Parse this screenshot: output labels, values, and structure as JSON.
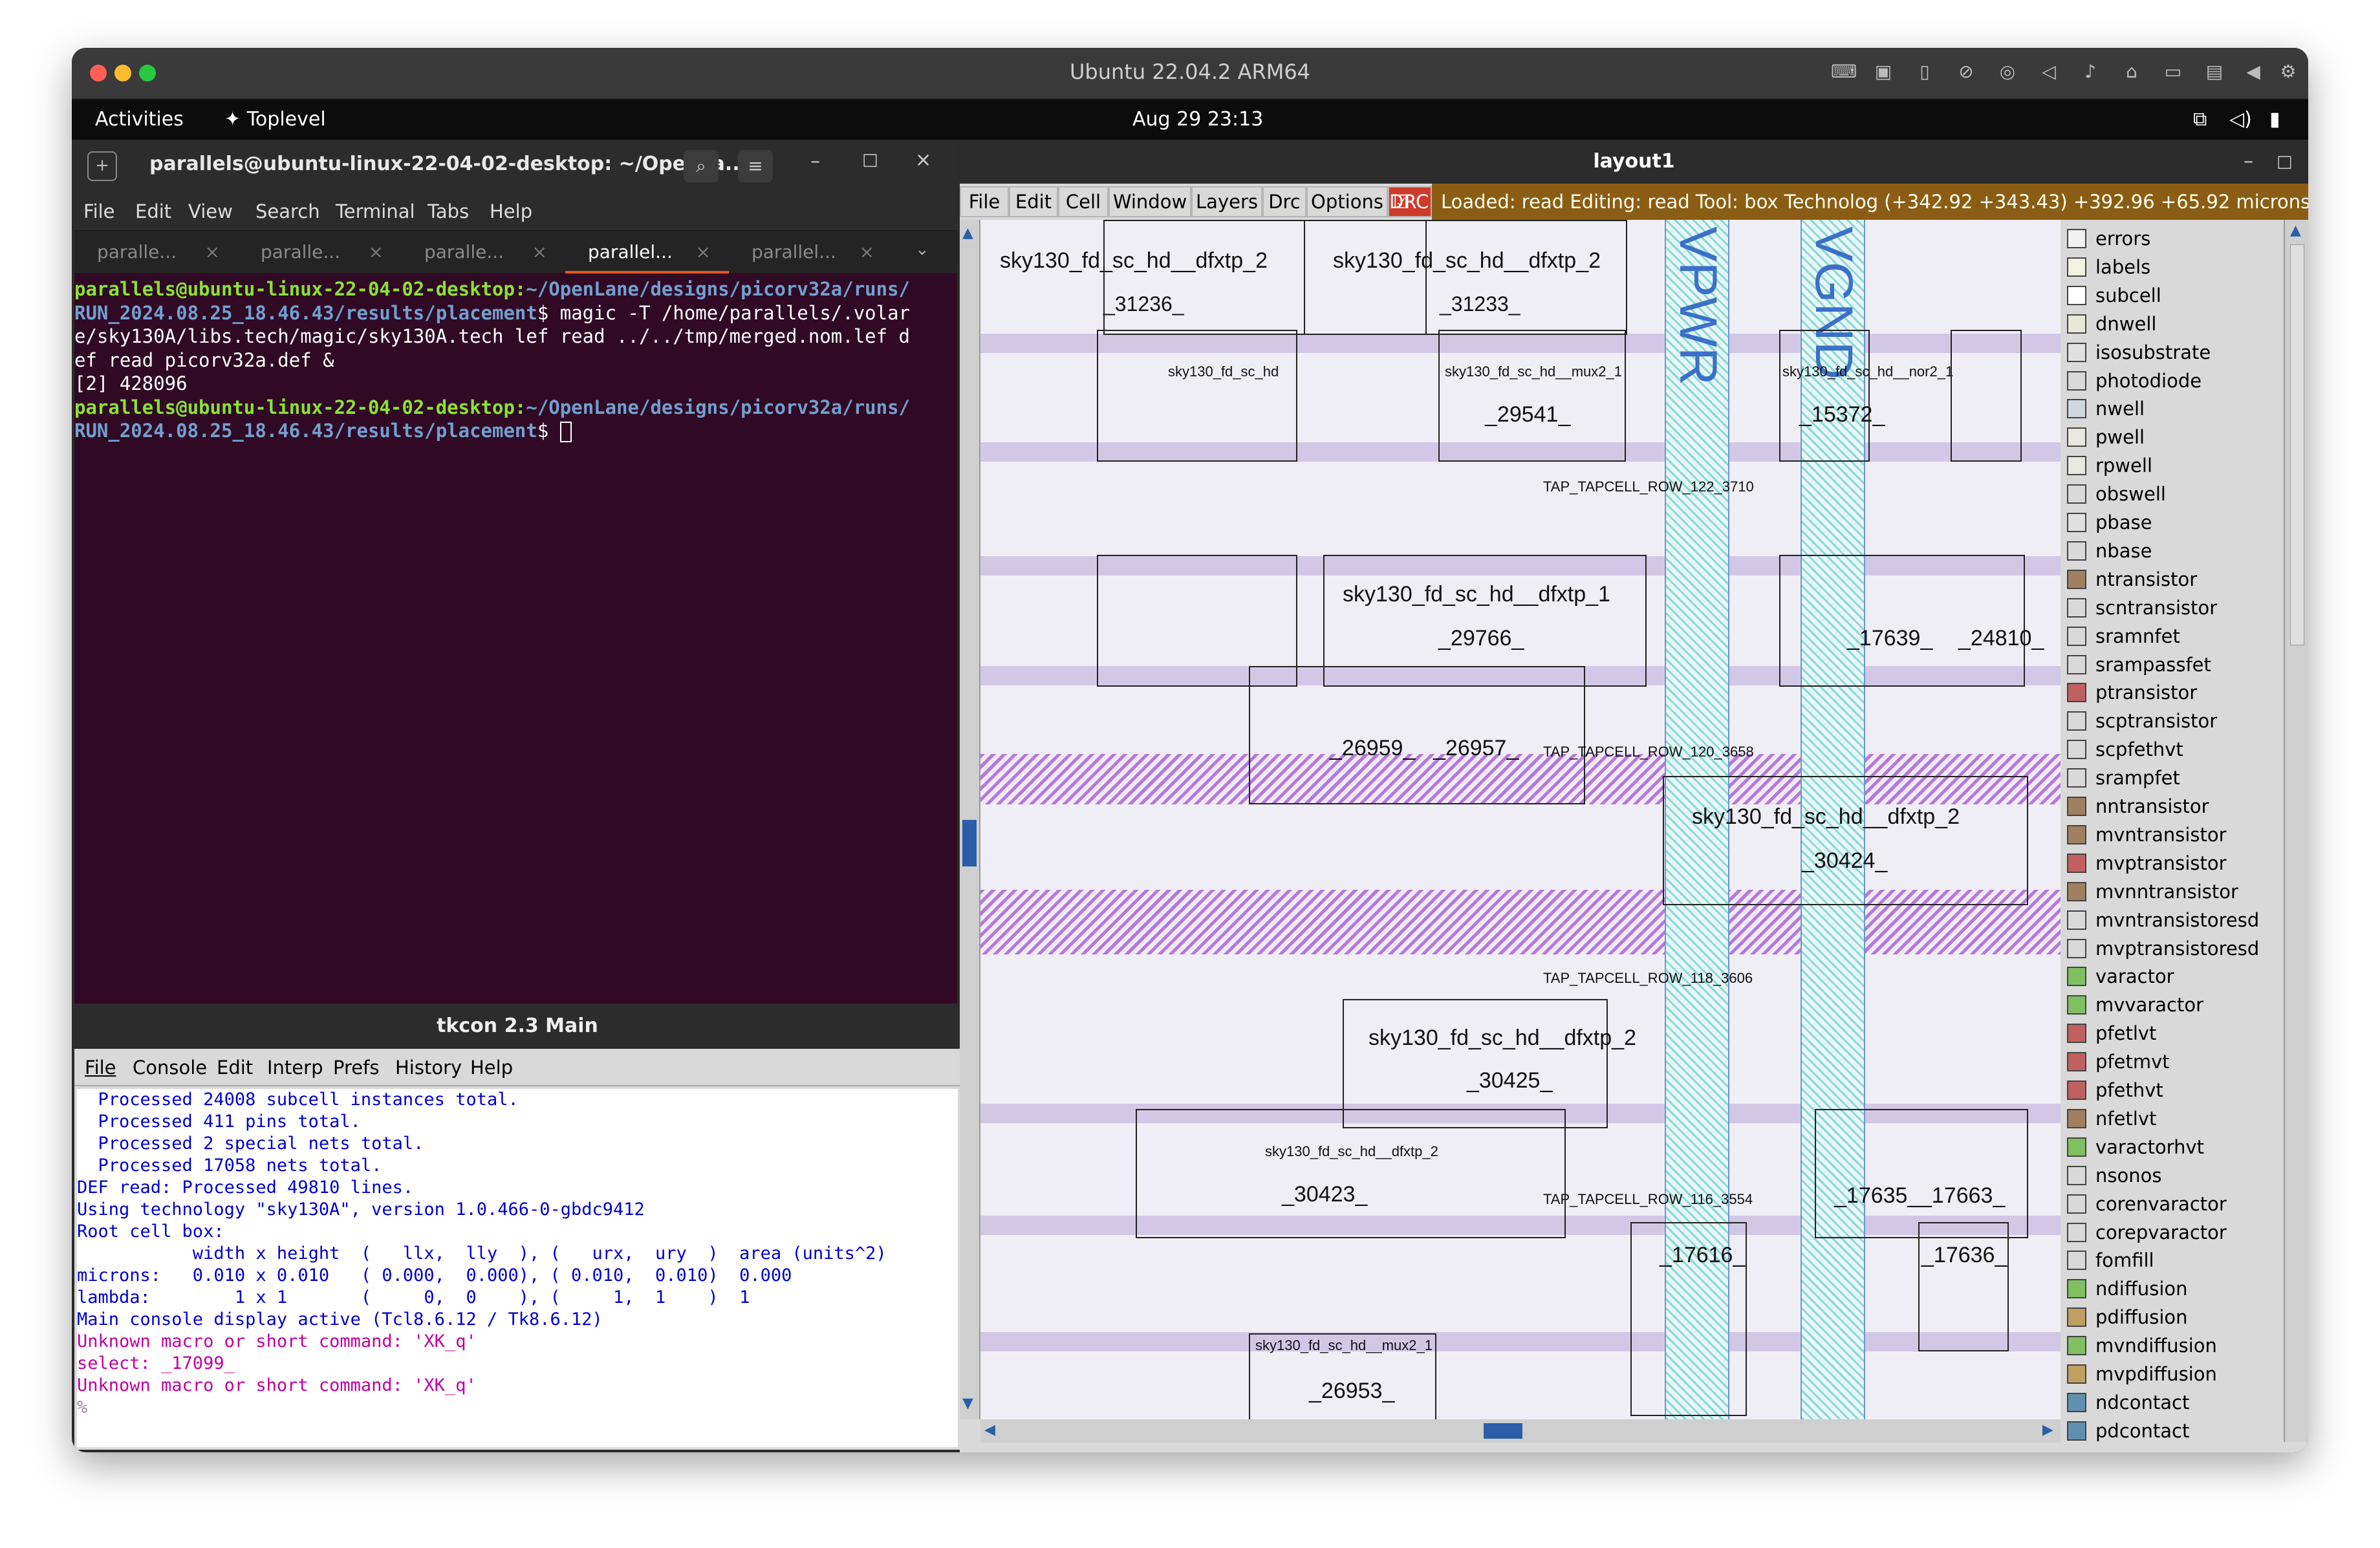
{
  "mac": {
    "title": "Ubuntu 22.04.2 ARM64"
  },
  "gnome": {
    "activities": "Activities",
    "app": "Toplevel",
    "clock": "Aug 29  23:13"
  },
  "terminal": {
    "title": "parallels@ubuntu-linux-22-04-02-desktop: ~/OpenLa...",
    "menu": [
      "File",
      "Edit",
      "View",
      "Search",
      "Terminal",
      "Tabs",
      "Help"
    ],
    "tabs": [
      "paralle...",
      "paralle...",
      "paralle...",
      "parallel...",
      "parallel..."
    ],
    "prompt_user": "parallels@ubuntu-linux-22-04-02-desktop:",
    "prompt_path1": "~/OpenLane/designs/picorv32a/runs/",
    "prompt_path2": "RUN_2024.08.25_18.46.43/results/placement",
    "cmd1": "$ magic -T /home/parallels/.volar",
    "cmd2": "e/sky130A/libs.tech/magic/sky130A.tech lef read ../../tmp/merged.nom.lef d",
    "cmd3": "ef read picorv32a.def &",
    "job": "[2] 428096",
    "prompt_end": "$ "
  },
  "tkcon": {
    "title": "tkcon 2.3 Main",
    "menu": [
      "File",
      "Console",
      "Edit",
      "Interp",
      "Prefs",
      "History",
      "Help"
    ],
    "lines": [
      "  Processed 24008 subcell instances total.",
      "  Processed 411 pins total.",
      "  Processed 2 special nets total.",
      "  Processed 17058 nets total.",
      "DEF read: Processed 49810 lines.",
      "Using technology \"sky130A\", version 1.0.466-0-gbdc9412",
      "Root cell box:",
      "           width x height  (   llx,  lly  ), (   urx,  ury  )  area (units^2)",
      "",
      "microns:   0.010 x 0.010   ( 0.000,  0.000), ( 0.010,  0.010)  0.000",
      "lambda:        1 x 1       (     0,  0    ), (     1,  1    )  1",
      "Main console display active (Tcl8.6.12 / Tk8.6.12)"
    ],
    "magenta": [
      "Unknown macro or short command: 'XK_q'",
      "Unknown macro or short command: 'XK_q'"
    ],
    "select": "select: _17099_",
    "prompt": "%"
  },
  "layout": {
    "title": "layout1",
    "menu": [
      "File",
      "Edit",
      "Cell",
      "Window",
      "Layers",
      "Drc",
      "Options",
      "DRC"
    ],
    "status": "Loaded: read Editing: read Tool: box  Technolog   (+342.92 +343.43) +392.96 +65.92 microns",
    "cells": [
      {
        "t": "sky130_fd_sc_hd__dfxtp_2",
        "s": "_31236_"
      },
      {
        "t": "sky130_fd_sc_hd__dfxtp_2",
        "s": "_31233_"
      },
      {
        "t": "sky130_fd_sc_hd__dfxtp_1",
        "s": "_29766_"
      },
      {
        "t": "sky130_fd_sc_hd__mux2_1",
        "s": "_29541_"
      },
      {
        "t": "sky130_fd_sc_hd__dfxtp_2",
        "s": "_30424_"
      },
      {
        "t": "sky130_fd_sc_hd__dfxtp_2",
        "s": "_30425_"
      },
      {
        "t": "sky130_fd_sc_hd__dfxtp_2",
        "s": "_30423_"
      },
      {
        "t": "sky130_fd_sc_hd__nor2_1",
        "s": "_15372_"
      },
      {
        "t": "",
        "s": "_17639_"
      },
      {
        "t": "",
        "s": "_24810_"
      },
      {
        "t": "",
        "s": "_26959_"
      },
      {
        "t": "",
        "s": "_26957_"
      },
      {
        "t": "",
        "s": "_17635_"
      },
      {
        "t": "",
        "s": "_17663_"
      },
      {
        "t": "",
        "s": "_17616_"
      },
      {
        "t": "",
        "s": "_17636_"
      },
      {
        "t": "sky130_fd_sc_hd__mux2_1",
        "s": "_26953_"
      }
    ],
    "taps": [
      "TAP_TAPCELL_ROW_122_3710",
      "TAP_TAPCELL_ROW_120_3658",
      "TAP_TAPCELL_ROW_118_3606",
      "TAP_TAPCELL_ROW_116_3554"
    ],
    "layers": [
      "errors",
      "labels",
      "subcell",
      "dnwell",
      "isosubstrate",
      "photodiode",
      "nwell",
      "pwell",
      "rpwell",
      "obswell",
      "pbase",
      "nbase",
      "ntransistor",
      "scntransistor",
      "sramnfet",
      "srampassfet",
      "ptransistor",
      "scptransistor",
      "scpfethvt",
      "srampfet",
      "nntransistor",
      "mvntransistor",
      "mvptransistor",
      "mvnntransistor",
      "mvntransistoresd",
      "mvptransistoresd",
      "varactor",
      "mvvaractor",
      "pfetlvt",
      "pfetmvt",
      "pfethvt",
      "nfetlvt",
      "varactorhvt",
      "nsonos",
      "corenvaractor",
      "corepvaractor",
      "fomfill",
      "ndiffusion",
      "pdiffusion",
      "mvndiffusion",
      "mvpdiffusion",
      "ndcontact",
      "pdcontact"
    ],
    "layer_colors": [
      "#f2f2f2",
      "#f2f2e0",
      "#ffffff",
      "#e8e8d8",
      "#e0e0e0",
      "#d9d9d9",
      "#cfd8e0",
      "#e8e8e0",
      "#e8e8e0",
      "#d9d9d9",
      "#e0e0e0",
      "#d9d9d9",
      "#a08060",
      "#d9d9d9",
      "#d9d9d9",
      "#d9d9d9",
      "#c06060",
      "#d9d9d9",
      "#d9d9d9",
      "#d9d9d9",
      "#a08060",
      "#a08060",
      "#c06060",
      "#a08060",
      "#d9d9d9",
      "#d9d9d9",
      "#80c060",
      "#80c060",
      "#c06060",
      "#c06060",
      "#c06060",
      "#a08060",
      "#80c060",
      "#d9d9d9",
      "#d9d9d9",
      "#d9d9d9",
      "#d9d9d9",
      "#80c060",
      "#c0a060",
      "#80c060",
      "#c0a060",
      "#6090b0",
      "#6090b0"
    ]
  }
}
